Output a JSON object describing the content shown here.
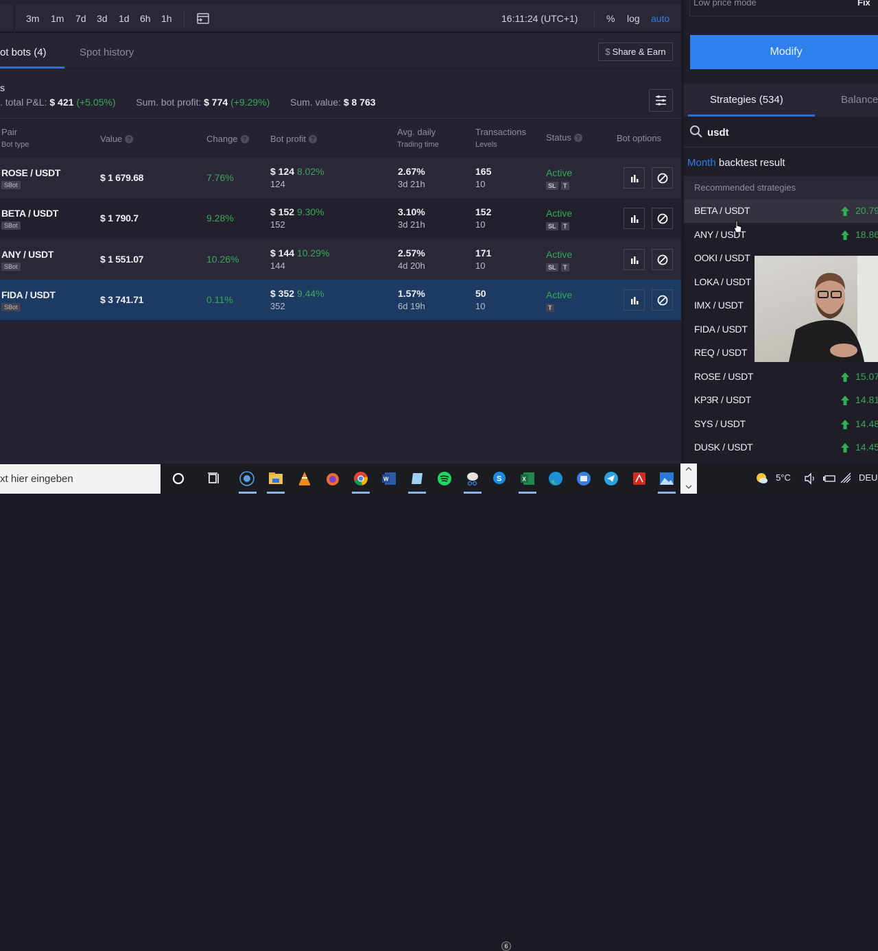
{
  "toolbar": {
    "timeframes": [
      "3m",
      "1m",
      "7d",
      "3d",
      "1d",
      "6h",
      "1h"
    ],
    "clock": "16:11:24 (UTC+1)",
    "percent_label": "%",
    "log_label": "log",
    "auto_label": "auto"
  },
  "tabs": {
    "spot_bots": "ot bots (4)",
    "spot_history": "Spot history",
    "share_label": "Share & Earn",
    "share_icon": "$"
  },
  "summary": {
    "dot": "s",
    "pnl_label": ". total P&L:",
    "pnl_value": "$ 421",
    "pnl_pct": "(+5.05%)",
    "profit_label": "Sum. bot profit:",
    "profit_value": "$ 774",
    "profit_pct": "(+9.29%)",
    "value_label": "Sum. value:",
    "value_value": "$ 8 763"
  },
  "table": {
    "headers": {
      "pair": "Pair",
      "bot_type": "Bot type",
      "value": "Value",
      "change": "Change",
      "bot_profit": "Bot profit",
      "avg_daily": "Avg. daily",
      "trading_time": "Trading time",
      "transactions": "Transactions",
      "levels": "Levels",
      "status": "Status",
      "bot_options": "Bot options",
      "help": "?"
    },
    "rows": [
      {
        "pair": "ROSE / USDT",
        "bot_type": "SBot",
        "value": "$ 1 679.68",
        "change": "7.76%",
        "profit": "$ 124",
        "profit_pct": "8.02%",
        "profit_sub": "124",
        "avg": "2.67%",
        "time": "3d 21h",
        "tx": "165",
        "levels": "10",
        "status": "Active",
        "tags": [
          "SL",
          "T"
        ]
      },
      {
        "pair": "BETA / USDT",
        "bot_type": "SBot",
        "value": "$ 1 790.7",
        "change": "9.28%",
        "profit": "$ 152",
        "profit_pct": "9.30%",
        "profit_sub": "152",
        "avg": "3.10%",
        "time": "3d 21h",
        "tx": "152",
        "levels": "10",
        "status": "Active",
        "tags": [
          "SL",
          "T"
        ]
      },
      {
        "pair": "ANY / USDT",
        "bot_type": "SBot",
        "value": "$ 1 551.07",
        "change": "10.26%",
        "profit": "$ 144",
        "profit_pct": "10.29%",
        "profit_sub": "144",
        "avg": "2.57%",
        "time": "4d 20h",
        "tx": "171",
        "levels": "10",
        "status": "Active",
        "tags": [
          "SL",
          "T"
        ]
      },
      {
        "pair": "FIDA / USDT",
        "bot_type": "SBot",
        "value": "$ 3 741.71",
        "change": "0.11%",
        "profit": "$ 352",
        "profit_pct": "9.44%",
        "profit_sub": "352",
        "avg": "1.57%",
        "time": "6d 19h",
        "tx": "50",
        "levels": "10",
        "status": "Active",
        "tags": [
          "T"
        ]
      }
    ]
  },
  "right_panel": {
    "low_price_label": "Low price mode",
    "low_price_value": "Fix",
    "modify_label": "Modify",
    "strategies_tab": "Strategies (534)",
    "balance_tab": "Balance",
    "search_value": "usdt",
    "backtest_period": "Month",
    "backtest_label": " backtest result",
    "recommended_label": "Recommended strategies",
    "strategies": [
      {
        "pair": "BETA / USDT",
        "pct": "20.79"
      },
      {
        "pair": "ANY / USDT",
        "pct": "18.86"
      },
      {
        "pair": "OOKI / USDT",
        "pct": ""
      },
      {
        "pair": "LOKA / USDT",
        "pct": ""
      },
      {
        "pair": "IMX / USDT",
        "pct": ""
      },
      {
        "pair": "FIDA / USDT",
        "pct": ""
      },
      {
        "pair": "REQ / USDT",
        "pct": ""
      },
      {
        "pair": "ROSE / USDT",
        "pct": "15.07"
      },
      {
        "pair": "KP3R / USDT",
        "pct": "14.81"
      },
      {
        "pair": "SYS / USDT",
        "pct": "14.48"
      },
      {
        "pair": "DUSK / USDT",
        "pct": "14.45"
      }
    ]
  },
  "taskbar": {
    "search_placeholder": "xt hier eingeben",
    "temperature": "5°C",
    "language": "DEU",
    "skype_badge": "6"
  },
  "colors": {
    "accent": "#2f80ec",
    "positive": "#3aa85a",
    "selected_row": "#1d3a63"
  }
}
